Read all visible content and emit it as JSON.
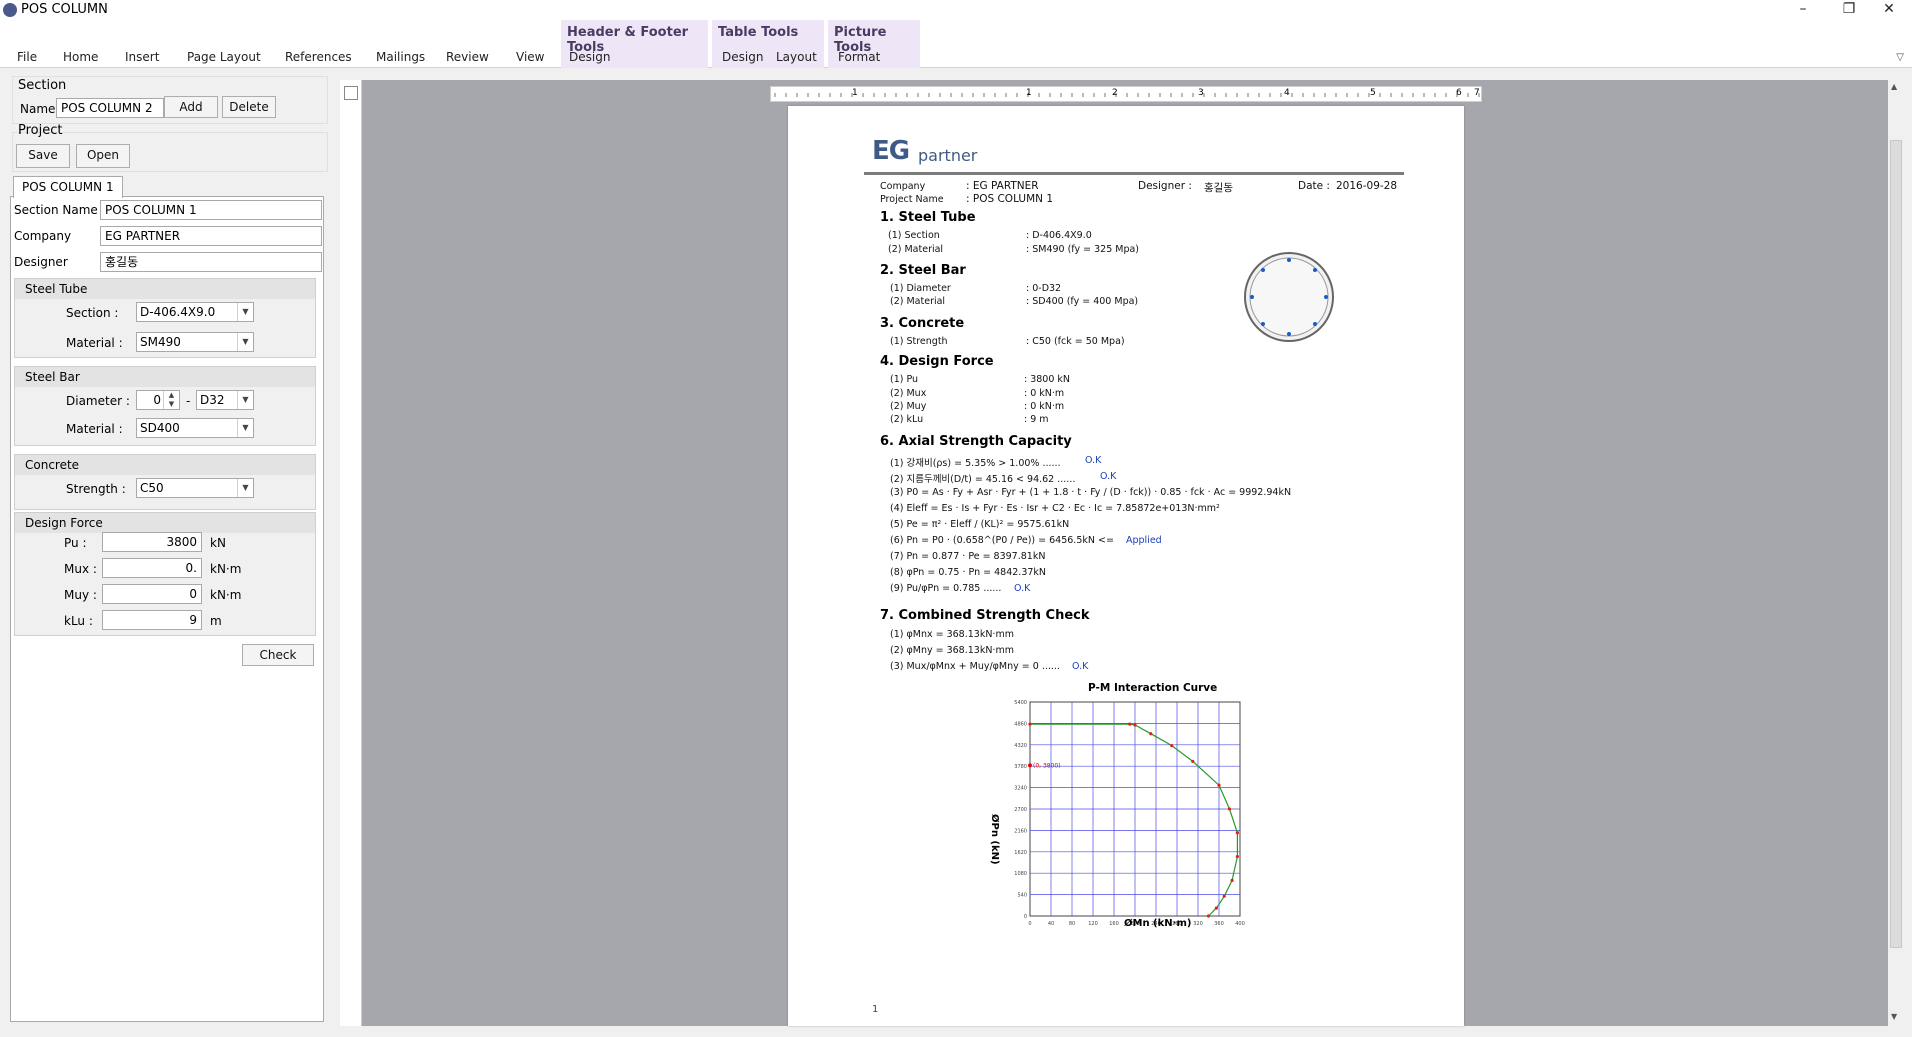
{
  "window": {
    "title": "POS COLUMN",
    "controls": {
      "minimize": "–",
      "restore": "❐",
      "close": "✕"
    }
  },
  "ribbon": {
    "tabs": [
      "File",
      "Home",
      "Insert",
      "Page Layout",
      "References",
      "Mailings",
      "Review",
      "View"
    ],
    "contextual": [
      {
        "group": "Header & Footer Tools",
        "tabs": [
          "Design"
        ]
      },
      {
        "group": "Table Tools",
        "tabs": [
          "Design",
          "Layout"
        ]
      },
      {
        "group": "Picture Tools",
        "tabs": [
          "Format"
        ]
      }
    ]
  },
  "left": {
    "section": {
      "label": "Section",
      "name_label": "Name",
      "name_value": "POS COLUMN 2",
      "add": "Add",
      "delete": "Delete"
    },
    "project": {
      "label": "Project",
      "save": "Save",
      "open": "Open"
    },
    "tab_label": "POS COLUMN 1",
    "fields": {
      "section_name_label": "Section Name",
      "section_name": "POS COLUMN 1",
      "company_label": "Company",
      "company": "EG PARTNER",
      "designer_label": "Designer",
      "designer": "홍길동"
    },
    "steel_tube": {
      "title": "Steel Tube",
      "section_label": "Section :",
      "section": "D-406.4X9.0",
      "material_label": "Material :",
      "material": "SM490"
    },
    "steel_bar": {
      "title": "Steel Bar",
      "diameter_label": "Diameter :",
      "count": "0",
      "dash": "-",
      "diameter": "D32",
      "material_label": "Material :",
      "material": "SD400"
    },
    "concrete": {
      "title": "Concrete",
      "strength_label": "Strength :",
      "strength": "C50"
    },
    "design_force": {
      "title": "Design Force",
      "pu_label": "Pu :",
      "pu": "3800",
      "pu_unit": "kN",
      "mux_label": "Mux :",
      "mux": "0.",
      "mux_unit": "kN·m",
      "muy_label": "Muy :",
      "muy": "0",
      "muy_unit": "kN·m",
      "klu_label": "kLu :",
      "klu": "9",
      "klu_unit": "m"
    },
    "check": "Check"
  },
  "ruler": {
    "numbers": [
      "1",
      "1",
      "2",
      "3",
      "4",
      "5",
      "6",
      "7"
    ]
  },
  "doc": {
    "logo": {
      "eg": "EG",
      "partner": "partner"
    },
    "header": {
      "company_label": "Company",
      "company": ": EG PARTNER",
      "project_label": "Project Name",
      "project": ": POS COLUMN 1",
      "designer_label": "Designer :",
      "designer": "홍길동",
      "date_label": "Date :",
      "date": "2016-09-28"
    },
    "s1": {
      "title": "1. Steel Tube",
      "l1": "(1) Section",
      "v1": ":  D-406.4X9.0",
      "l2": "(2) Material",
      "v2": ":  SM490 (fy = 325 Mpa)"
    },
    "s2": {
      "title": "2. Steel Bar",
      "l1": "(1) Diameter",
      "v1": ":  0-D32",
      "l2": "(2) Material",
      "v2": ":  SD400 (fy = 400 Mpa)"
    },
    "s3": {
      "title": "3. Concrete",
      "l1": "(1) Strength",
      "v1": ":  C50 (fck = 50 Mpa)"
    },
    "s4": {
      "title": "4. Design Force",
      "l1": "(1) Pu",
      "v1": ":  3800 kN",
      "l2": "(2) Mux",
      "v2": ":  0 kN·m",
      "l3": "(2) Muy",
      "v3": ":  0 kN·m",
      "l4": "(2) kLu",
      "v4": ":  9 m"
    },
    "s6": {
      "title": "6. Axial Strength Capacity",
      "lines": [
        "(1) 강재비(ρs) =  5.35%   >   1.00% ......",
        "(2) 지름두께비(D/t) =  45.16   <   94.62 ......",
        "(3) P0 = As · Fy + Asr · Fyr + (1 + 1.8 · t · Fy / (D · fck)) · 0.85 · fck · Ac =  9992.94kN",
        "(4) Eleff = Es · Is + Fyr · Es · Isr + C2 · Ec · Ic =  7.85872e+013N·mm²",
        "(5) Pe = π² · Eleff / (KL)² =  9575.61kN",
        "(6) Pn = P0 · (0.658^(P0 / Pe)) =  6456.5kN   <=",
        "(7) Pn = 0.877 · Pe =  8397.81kN",
        "(8) φPn = 0.75 · Pn =  4842.37kN",
        "(9) Pu/φPn =  0.785  ......"
      ],
      "ok": "O.K",
      "applied": "Applied"
    },
    "s7": {
      "title": "7. Combined Strength Check",
      "lines": [
        "(1) φMnx =  368.13kN·mm",
        "(2) φMny =  368.13kN·mm",
        "(3) Mux/φMnx + Muy/φMny =  0  ......"
      ],
      "ok": "O.K"
    },
    "chart": {
      "title": "P-M Interaction Curve",
      "xlabel": "ØMn (kN·m)",
      "ylabel": "ØPn (kN)",
      "marker": "(0, 3800)"
    },
    "page_number": "1"
  },
  "chart_data": {
    "type": "line",
    "title": "P-M Interaction Curve",
    "xlabel": "ØMn (kN·m)",
    "ylabel": "ØPn (kN)",
    "xlim": [
      0,
      400
    ],
    "ylim": [
      0,
      5400
    ],
    "grid": true,
    "series": [
      {
        "values": [
          [
            0,
            4842
          ],
          [
            190,
            4842
          ],
          [
            200,
            4820
          ],
          [
            230,
            4600
          ],
          [
            270,
            4300
          ],
          [
            310,
            3900
          ],
          [
            360,
            3300
          ],
          [
            380,
            2700
          ],
          [
            395,
            2100
          ],
          [
            395,
            1500
          ],
          [
            385,
            900
          ],
          [
            370,
            500
          ],
          [
            355,
            200
          ],
          [
            340,
            0
          ]
        ]
      }
    ],
    "point": {
      "x": 0,
      "y": 3800,
      "label": "(0, 3800)"
    }
  }
}
